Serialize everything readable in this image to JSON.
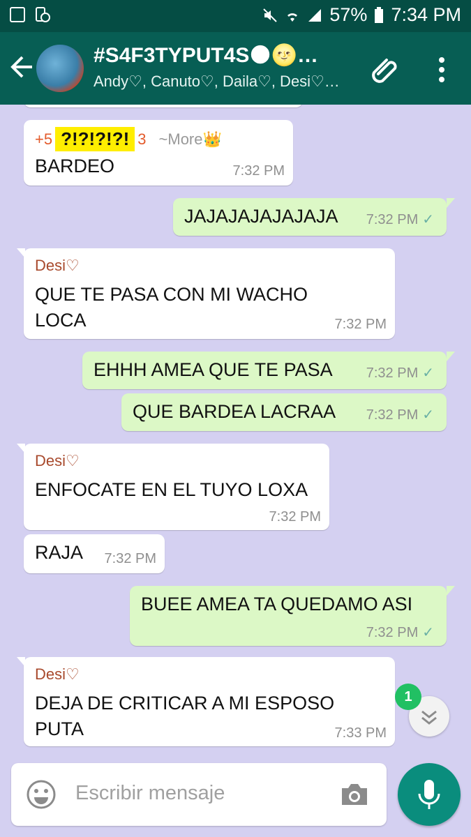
{
  "status_bar": {
    "battery": "57%",
    "time": "7:34 PM"
  },
  "header": {
    "title": "#S4F3TYPUT4S🌑🌝…",
    "subtitle": "Andy♡, Canuto♡, Daila♡, Desi♡…"
  },
  "messages": [
    {
      "type": "in",
      "sender_prefix": "+5",
      "sender_highlight": "?!?!?!?!",
      "sender_suffix": "3",
      "more": "~More👑",
      "text": "BARDEO",
      "time": "7:32 PM"
    },
    {
      "type": "out",
      "text": "JAJAJAJAJAJAJA",
      "time": "7:32 PM"
    },
    {
      "type": "in",
      "sender": "Desi♡",
      "text": "QUE TE PASA CON MI WACHO LOCA",
      "time": "7:32 PM"
    },
    {
      "type": "out",
      "text": "EHHH AMEA QUE TE PASA",
      "time": "7:32 PM"
    },
    {
      "type": "out",
      "text": "QUE BARDEA LACRAA",
      "time": "7:32 PM"
    },
    {
      "type": "in",
      "sender": "Desi♡",
      "text": "ENFOCATE EN EL TUYO LOXA",
      "time": "7:32 PM"
    },
    {
      "type": "in",
      "text": "RAJA",
      "time": "7:32 PM"
    },
    {
      "type": "out",
      "text": "BUEE AMEA TA QUEDAMO ASI",
      "time": "7:32 PM"
    },
    {
      "type": "in",
      "sender": "Desi♡",
      "text": "DEJA DE CRITICAR A MI ESPOSO PUTA",
      "time": "7:33 PM"
    }
  ],
  "unread_count": "1",
  "input": {
    "placeholder": "Escribir mensaje"
  },
  "colors": {
    "header": "#075e54",
    "statusbar": "#054d44",
    "chat_bg": "#d4d0f1",
    "outgoing": "#dcf8c6",
    "incoming": "#ffffff",
    "accent": "#0a8d7d"
  }
}
